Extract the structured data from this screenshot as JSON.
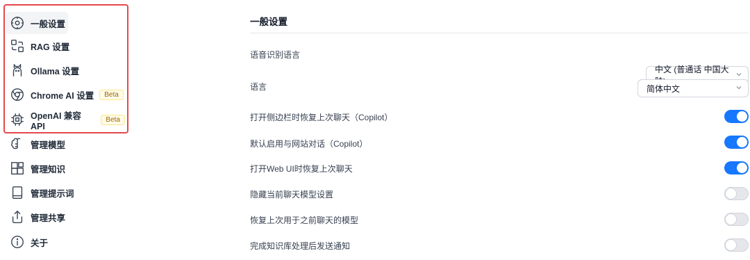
{
  "sidebar": {
    "items": [
      {
        "label": "一般设置",
        "icon": "gear-icon",
        "active": true
      },
      {
        "label": "RAG 设置",
        "icon": "rag-flow-icon"
      },
      {
        "label": "Ollama 设置",
        "icon": "llama-icon"
      },
      {
        "label": "Chrome AI 设置",
        "icon": "chrome-icon",
        "badge": "Beta"
      },
      {
        "label": "OpenAI 兼容 API",
        "icon": "cpu-chip-icon",
        "badge": "Beta"
      },
      {
        "label": "管理模型",
        "icon": "brain-icon"
      },
      {
        "label": "管理知识",
        "icon": "blocks-icon"
      },
      {
        "label": "管理提示词",
        "icon": "book-icon"
      },
      {
        "label": "管理共享",
        "icon": "share-icon"
      },
      {
        "label": "关于",
        "icon": "info-icon"
      }
    ]
  },
  "main": {
    "title": "一般设置",
    "settings": [
      {
        "label": "语音识别语言",
        "type": "select",
        "value": "中文 (普通话 中国大陆)"
      },
      {
        "label": "语言",
        "type": "select",
        "value": "简体中文"
      },
      {
        "label": "打开侧边栏时恢复上次聊天（Copilot）",
        "type": "toggle",
        "on": true
      },
      {
        "label": "默认启用与网站对话（Copilot）",
        "type": "toggle",
        "on": true
      },
      {
        "label": "打开Web UI时恢复上次聊天",
        "type": "toggle",
        "on": true
      },
      {
        "label": "隐藏当前聊天模型设置",
        "type": "toggle",
        "on": false
      },
      {
        "label": "恢复上次用于之前聊天的模型",
        "type": "toggle",
        "on": false
      },
      {
        "label": "完成知识库处理后发送通知",
        "type": "toggle",
        "on": false
      }
    ]
  },
  "colors": {
    "accent": "#1677ff",
    "highlight": "#e5484d",
    "beta_text": "#a16207"
  }
}
